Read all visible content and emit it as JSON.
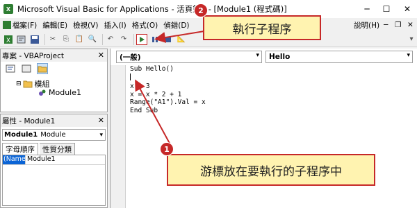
{
  "window": {
    "title": "Microsoft Visual Basic for Applications - 活頁簿1 - [Module1 (程式碼)]",
    "minimize_glyph": "─",
    "maximize_glyph": "☐",
    "close_glyph": "✕"
  },
  "menu": {
    "items": [
      {
        "label": "檔案(F)"
      },
      {
        "label": "編輯(E)"
      },
      {
        "label": "檢視(V)"
      },
      {
        "label": "插入(I)"
      },
      {
        "label": "格式(O)"
      },
      {
        "label": "偵錯(D)"
      },
      {
        "label": "說明(H)"
      }
    ],
    "mdi_minimize": "─",
    "mdi_restore": "❐",
    "mdi_close": "✕"
  },
  "toolbar": {
    "run_icon": "run-triangle-icon"
  },
  "project_panel": {
    "title": "專案 - VBAProject",
    "close": "✕",
    "tree": {
      "folder_label": "模組",
      "module_label": "Module1"
    }
  },
  "properties_panel": {
    "title": "屬性 - Module1",
    "close": "✕",
    "object_selector": {
      "name": "Module1",
      "type": "Module"
    },
    "tabs": [
      {
        "label": "字母順序"
      },
      {
        "label": "性質分類"
      }
    ],
    "row": {
      "name": "(Name)",
      "value": "Module1"
    }
  },
  "code_window": {
    "object_combo": "(一般)",
    "procedure_combo": "Hello",
    "lines": [
      "Sub Hello()",
      "",
      "x = 3",
      "x = x * 2 + 1",
      "Range(\"A1\").Val = x",
      "",
      "End Sub"
    ]
  },
  "annotations": {
    "callout_1": {
      "number": "1",
      "text": "游標放在要執行的子程序中"
    },
    "callout_2": {
      "number": "2",
      "text": "執行子程序"
    },
    "color": "#c62828",
    "fill": "#fff3b0"
  }
}
